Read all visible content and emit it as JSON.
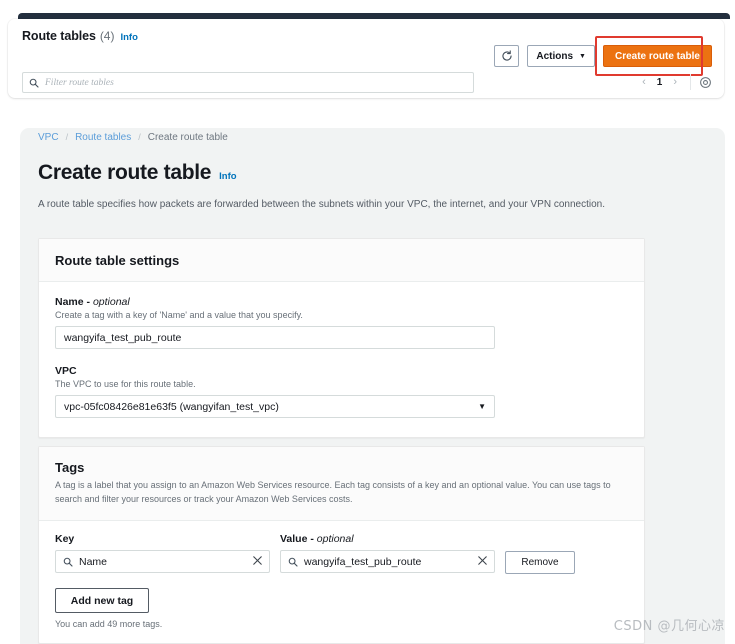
{
  "list_panel": {
    "title": "Route tables",
    "count": "(4)",
    "info_label": "Info",
    "filter_placeholder": "Filter route tables",
    "search_icon": "search-icon",
    "refresh_icon": "refresh-icon",
    "actions_label": "Actions",
    "actions_caret": "▼",
    "create_label": "Create route table",
    "pagination": {
      "prev": "‹",
      "page": "1",
      "next": "›",
      "settings_icon": "gear-icon"
    }
  },
  "breadcrumb": {
    "items": [
      {
        "label": "VPC",
        "current": false
      },
      {
        "label": "Route tables",
        "current": false
      },
      {
        "label": "Create route table",
        "current": true
      }
    ],
    "separator": "/"
  },
  "page": {
    "title": "Create route table",
    "info_label": "Info",
    "description": "A route table specifies how packets are forwarded between the subnets within your VPC, the internet, and your VPN connection."
  },
  "settings_card": {
    "title": "Route table settings",
    "name_field": {
      "label": "Name - ",
      "label_optional": "optional",
      "hint": "Create a tag with a key of 'Name' and a value that you specify.",
      "value": "wangyifa_test_pub_route"
    },
    "vpc_field": {
      "label": "VPC",
      "hint": "The VPC to use for this route table.",
      "value": "vpc-05fc08426e81e63f5 (wangyifan_test_vpc)",
      "caret": "▼"
    }
  },
  "tags_card": {
    "title": "Tags",
    "description": "A tag is a label that you assign to an Amazon Web Services resource. Each tag consists of a key and an optional value. You can use tags to search and filter your resources or track your Amazon Web Services costs.",
    "key_header": "Key",
    "value_header": "Value - ",
    "value_header_optional": "optional",
    "rows": [
      {
        "key": "Name",
        "value": "wangyifa_test_pub_route",
        "remove_label": "Remove",
        "clear_icon": "close-icon",
        "search_icon": "search-icon"
      }
    ],
    "add_tag_label": "Add new tag",
    "tags_note": "You can add 49 more tags."
  },
  "watermark": "CSDN @几何心凉",
  "colors": {
    "accent_orange": "#ec7211",
    "highlight_red": "#e03a2f",
    "link_blue": "#0073bb",
    "navbar_dark": "#232f3e",
    "panel_gray": "#f1f3f3"
  }
}
